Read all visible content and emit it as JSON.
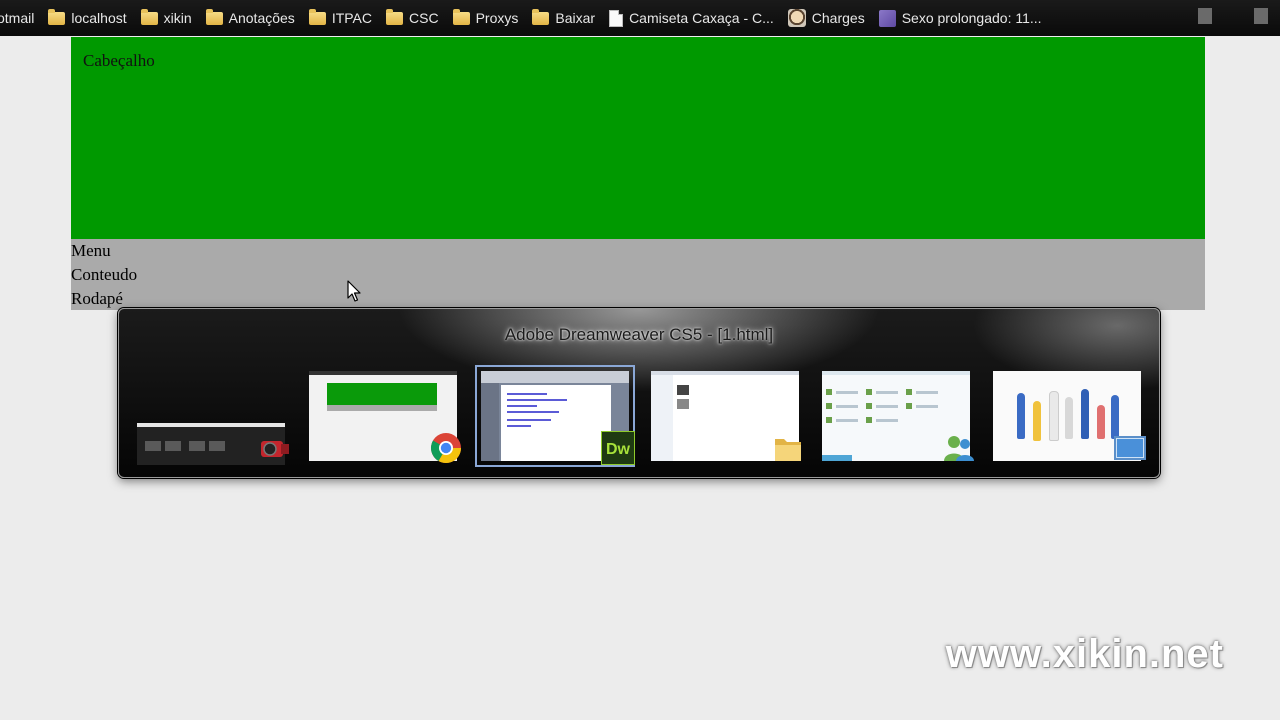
{
  "bookmarks_bar": {
    "items": [
      {
        "label": "otmail",
        "icon": "none"
      },
      {
        "label": "localhost",
        "icon": "folder-icon"
      },
      {
        "label": "xikin",
        "icon": "folder-icon"
      },
      {
        "label": "Anotações",
        "icon": "folder-icon"
      },
      {
        "label": "ITPAC",
        "icon": "folder-icon"
      },
      {
        "label": "CSC",
        "icon": "folder-icon"
      },
      {
        "label": "Proxys",
        "icon": "folder-icon"
      },
      {
        "label": "Baixar",
        "icon": "folder-icon"
      },
      {
        "label": "Camiseta Caxaça - C...",
        "icon": "page-icon"
      },
      {
        "label": "Charges",
        "icon": "face-icon"
      },
      {
        "label": "Sexo prolongado: 11...",
        "icon": "purple-icon"
      }
    ]
  },
  "page": {
    "header_text": "Cabeçalho",
    "menu_text": "Menu",
    "content_text": "Conteudo",
    "footer_text": "Rodapé",
    "header_color": "#009900",
    "body_color": "#aaaaaa"
  },
  "task_switcher": {
    "title": "Adobe Dreamweaver CS5 - [1.html]",
    "selected_index": 2,
    "windows": [
      {
        "app": "video-editor",
        "badge_icon": "camera-icon"
      },
      {
        "app": "chrome",
        "badge_icon": "chrome-icon"
      },
      {
        "app": "dreamweaver",
        "badge_icon": "dreamweaver-icon",
        "badge_text": "Dw"
      },
      {
        "app": "explorer",
        "badge_icon": "folder-icon"
      },
      {
        "app": "messenger",
        "badge_icon": "messenger-icon"
      },
      {
        "app": "desktop",
        "badge_icon": "desktop-icon"
      }
    ]
  },
  "watermark": "www.xikin.net"
}
